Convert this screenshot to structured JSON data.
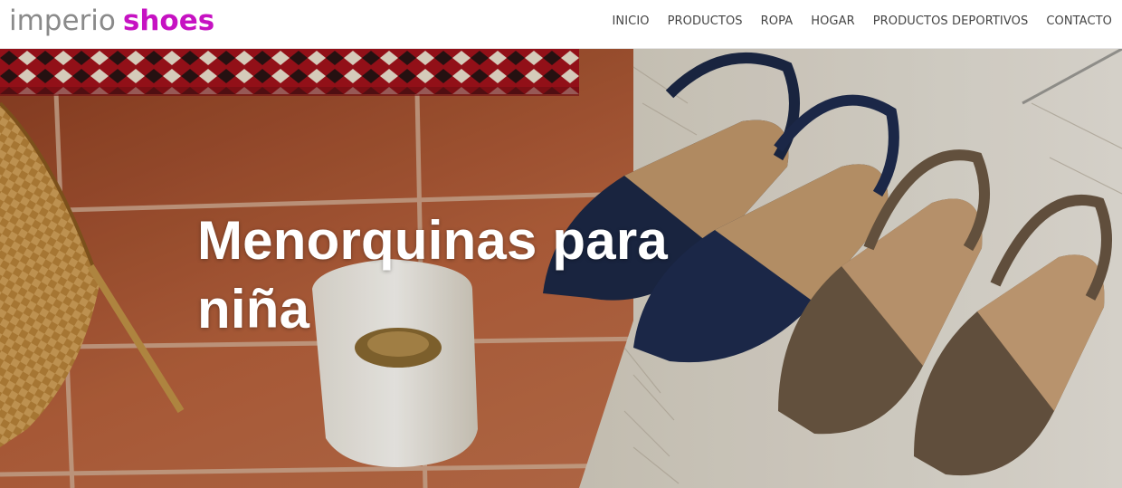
{
  "header": {
    "logo": {
      "part1": "imperio",
      "part2": "shoes"
    },
    "nav": [
      {
        "label": "INICIO"
      },
      {
        "label": "PRODUCTOS"
      },
      {
        "label": "ROPA"
      },
      {
        "label": "HOGAR"
      },
      {
        "label": "PRODUCTOS DEPORTIVOS"
      },
      {
        "label": "CONTACTO"
      }
    ]
  },
  "hero": {
    "title": "Menorquinas para niña"
  },
  "colors": {
    "logo_grey": "#8a8a8a",
    "logo_accent": "#c612c2",
    "nav_text": "#444444"
  }
}
